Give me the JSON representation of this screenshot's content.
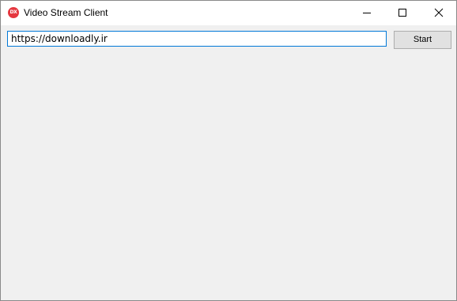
{
  "window": {
    "title": "Video Stream Client",
    "icon_text": "DX",
    "icon_color": "#e5373f"
  },
  "caption_buttons": {
    "minimize": "minimize-icon",
    "maximize": "maximize-icon",
    "close": "close-icon"
  },
  "toolbar": {
    "url_value": "https://downloadly.ir",
    "start_label": "Start"
  },
  "colors": {
    "focus_border": "#0078d7",
    "client_background": "#f0f0f0"
  }
}
